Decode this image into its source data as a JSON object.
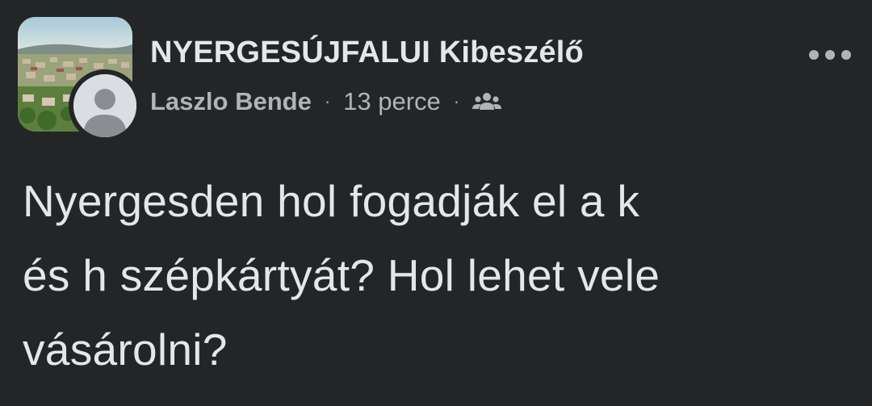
{
  "post": {
    "group_name": "NYERGESÚJFALUI Kibeszélő",
    "author": "Laszlo Bende",
    "separator": "·",
    "time": "13 perce",
    "audience_icon": "group-audience-icon",
    "more_icon": "more-options-icon",
    "text_lines": [
      "Nyergesden hol fogadják el a k",
      "és h szépkártyát? Hol lehet vele",
      "vásárolni?"
    ]
  },
  "colors": {
    "background": "#242526",
    "primary_text": "#e4e6eb",
    "secondary_text": "#b0b3b8"
  }
}
